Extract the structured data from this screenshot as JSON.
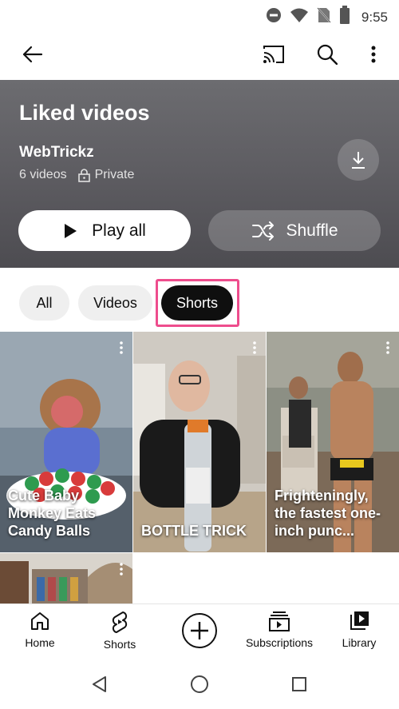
{
  "status": {
    "time": "9:55"
  },
  "appbar": {
    "back": "back-arrow-icon",
    "cast": "cast-icon",
    "search": "search-icon",
    "more": "more-vert-icon"
  },
  "playlist": {
    "title": "Liked videos",
    "owner": "WebTrickz",
    "count": "6 videos",
    "privacy": "Private",
    "play_all": "Play all",
    "shuffle": "Shuffle"
  },
  "chips": [
    {
      "label": "All",
      "selected": false
    },
    {
      "label": "Videos",
      "selected": false
    },
    {
      "label": "Shorts",
      "selected": true
    }
  ],
  "shorts": [
    {
      "caption": "Cute Baby Monkey Eats Candy Balls"
    },
    {
      "caption": "BOTTLE TRICK"
    },
    {
      "caption": "Frighteningly, the fastest one-inch punc..."
    },
    {
      "caption": ""
    }
  ],
  "bottom_nav": [
    {
      "label": "Home",
      "icon": "home-icon"
    },
    {
      "label": "Shorts",
      "icon": "shorts-icon"
    },
    {
      "label": "",
      "icon": "create-plus-icon"
    },
    {
      "label": "Subscriptions",
      "icon": "subscriptions-icon"
    },
    {
      "label": "Library",
      "icon": "library-icon"
    }
  ],
  "colors": {
    "highlight": "#ee4d8d",
    "chip_active": "#0f0f0f",
    "header_bg": "#5f5e63"
  }
}
